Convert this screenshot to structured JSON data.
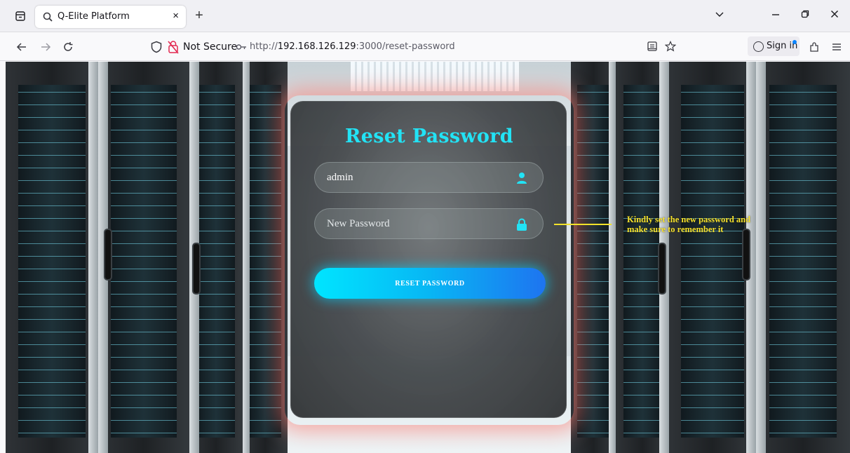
{
  "browser": {
    "tab_title": "Q-Elite Platform",
    "close_glyph": "×",
    "new_tab_glyph": "+",
    "security_label": "Not Secure",
    "url_prefix": "http://",
    "url_host": "192.168.126.129",
    "url_rest": ":3000/reset-password",
    "sign_in_label": "Sign in",
    "accent_color": "#0a84ff"
  },
  "form": {
    "title": "Reset Password",
    "username": {
      "value": "admin",
      "icon": "user-icon"
    },
    "new_password": {
      "value": "",
      "placeholder": "New Password",
      "icon": "lock-icon"
    },
    "submit_label": "RESET PASSWORD",
    "title_color": "#22e3f5",
    "button_colors": [
      "#00e5ff",
      "#1e74f0"
    ]
  },
  "annotation": {
    "text": "Kindly set the new password and make sure to remember it",
    "color": "#f7e22c"
  }
}
